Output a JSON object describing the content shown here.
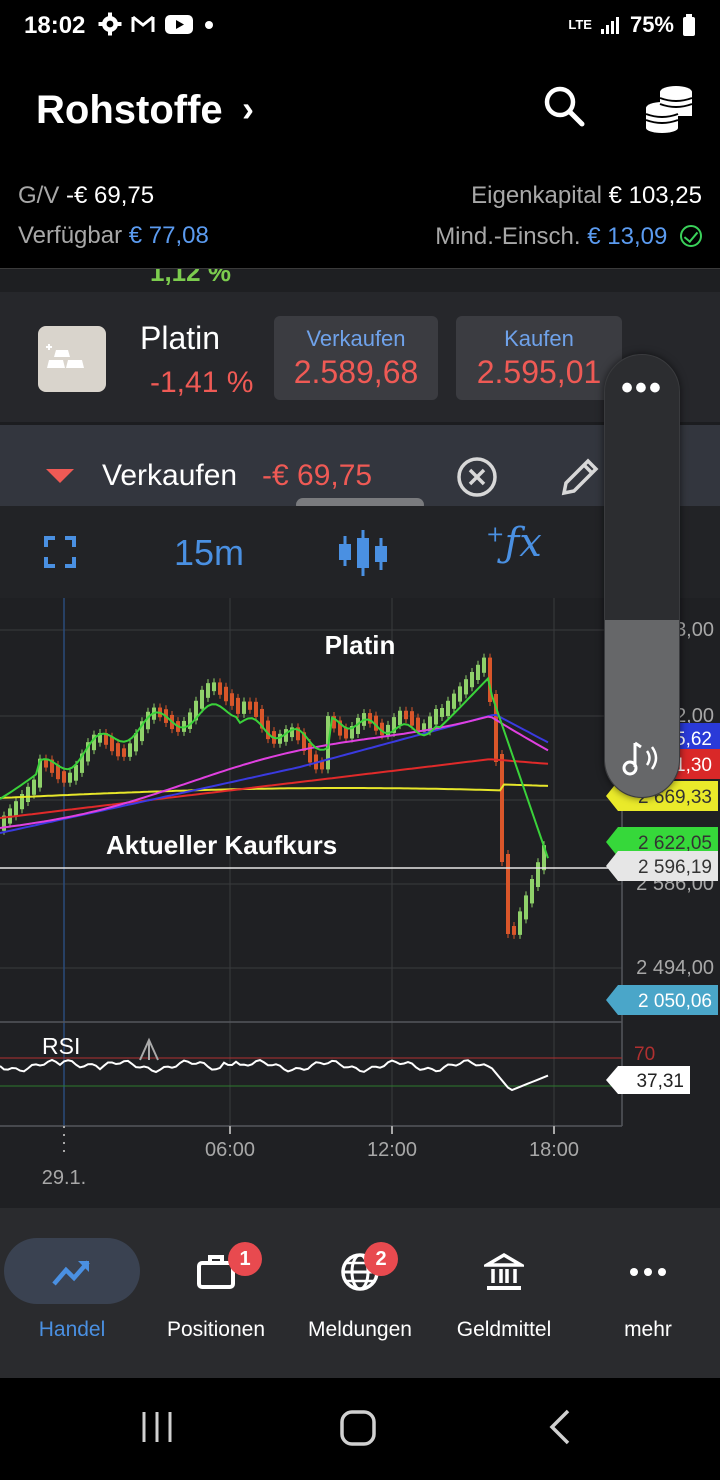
{
  "status": {
    "time": "18:02",
    "network": "LTE",
    "battery": "75%"
  },
  "header": {
    "title": "Rohstoffe"
  },
  "account": {
    "pl_label": "G/V",
    "pl_value": "-€ 69,75",
    "equity_label": "Eigenkapital",
    "equity_value": "€ 103,25",
    "available_label": "Verfügbar",
    "available_value": "€ 77,08",
    "margin_label": "Mind.-Einsch.",
    "margin_value": "€ 13,09"
  },
  "peek_value": "1,12 %",
  "instrument": {
    "name": "Platin",
    "change": "-1,41 %",
    "sell_label": "Verkaufen",
    "sell_price": "2.589,68",
    "buy_label": "Kaufen",
    "buy_price": "2.595,01"
  },
  "position": {
    "direction": "Verkaufen",
    "pl": "-€ 69,75"
  },
  "toolbar": {
    "timeframe": "15m"
  },
  "chart": {
    "title": "Platin",
    "annotation": "Aktueller Kaufkurs",
    "price_ticks": [
      "3,00",
      "2,00",
      "2 586,00",
      "2 494,00"
    ],
    "x_labels": [
      "29.1.",
      "06:00",
      "12:00",
      "18:00"
    ],
    "rsi_label": "RSI",
    "rsi_level": "70",
    "rsi_value": "37,31",
    "tags": [
      {
        "text": "5,62",
        "color": "#2a3ad8"
      },
      {
        "text": "1,30",
        "color": "#d92828"
      },
      {
        "text": "2 669,33",
        "color": "#eaea2a"
      },
      {
        "text": "2 622,05",
        "color": "#36d83a"
      },
      {
        "text": "2 596,19",
        "color": "#e6e6e6"
      },
      {
        "text": "2 050,06",
        "color": "#4aa6c9"
      }
    ]
  },
  "chart_data": {
    "type": "line",
    "title": "Platin",
    "x": [
      "29.1.",
      "06:00",
      "12:00",
      "18:00"
    ],
    "series": [
      {
        "color": "#3ad23a"
      },
      {
        "color": "#e040e0"
      },
      {
        "color": "#3a3ae0"
      },
      {
        "color": "#e02a2a"
      },
      {
        "color": "#e6e62a"
      }
    ],
    "price_ticks": [
      "3,00",
      "2,00",
      "2 586,00",
      "2 494,00"
    ],
    "rsi_value": 37.31,
    "rsi_level": 70
  },
  "nav": [
    {
      "label": "Handel",
      "icon": "trend-icon",
      "badge": ""
    },
    {
      "label": "Positionen",
      "icon": "briefcase-icon",
      "badge": "1"
    },
    {
      "label": "Meldungen",
      "icon": "globe-icon",
      "badge": "2"
    },
    {
      "label": "Geldmittel",
      "icon": "bank-icon",
      "badge": ""
    },
    {
      "label": "mehr",
      "icon": "more-icon",
      "badge": ""
    }
  ]
}
